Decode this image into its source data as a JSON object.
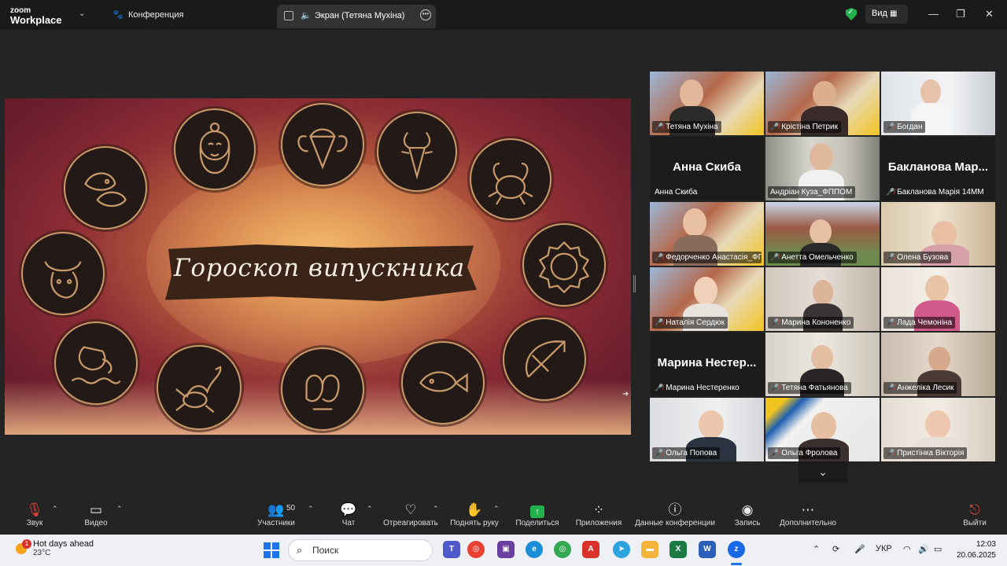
{
  "titlebar": {
    "logo_line1": "zoom",
    "logo_line2": "Workplace",
    "meeting_label": "Конференция",
    "share_tab_label": "Экран (Тетяна Мухіна)",
    "view_label": "Вид"
  },
  "slide": {
    "title": "Гороскоп випускника",
    "signs": [
      "virgo-sign-icon",
      "aries-sign-icon",
      "capricorn-sign-icon",
      "pisces-sign-icon",
      "cancer-sign-icon",
      "taurus-sign-icon",
      "leo-sign-icon",
      "aquarius-sign-icon",
      "scorpio-sign-icon",
      "gemini-sign-icon",
      "pisces-sign-icon",
      "sagittarius-sign-icon"
    ]
  },
  "gallery": {
    "tiles": [
      {
        "label": "Тетяна Мухіна",
        "muted": true
      },
      {
        "label": "Крістіна Петрик",
        "muted": true
      },
      {
        "label": "Богдан",
        "muted": true
      },
      {
        "label": "Анна Скиба",
        "big_name": "Анна Скиба",
        "muted": false
      },
      {
        "label": "Андріан Куза_ФППОМ",
        "muted": false,
        "active": true
      },
      {
        "label": "Бакланова Марія 14ММ",
        "big_name": "Бакланова Мар...",
        "muted": true
      },
      {
        "label": "Федорченко Анастасія_ФППОМ",
        "muted": true
      },
      {
        "label": "Анетта Омельченко",
        "muted": true
      },
      {
        "label": "Олена Бузова",
        "muted": true
      },
      {
        "label": "Наталія Сердюк",
        "muted": true
      },
      {
        "label": "Марина Кононенко",
        "muted": true
      },
      {
        "label": "Лада Чемоніна",
        "muted": true
      },
      {
        "label": "Марина Нестеренко",
        "big_name": "Марина Нестер...",
        "muted": true
      },
      {
        "label": "Тетяна Фатьянова",
        "muted": true
      },
      {
        "label": "Анжеліка Лесик",
        "muted": true
      },
      {
        "label": "Ольга Попова",
        "muted": true
      },
      {
        "label": "Ольга Фролова",
        "muted": true
      },
      {
        "label": "Пристінка Вікторія",
        "muted": true
      }
    ]
  },
  "toolbar": {
    "audio": "Звук",
    "video": "Видео",
    "participants": "Участники",
    "participants_count": "50",
    "chat": "Чат",
    "react": "Отреагировать",
    "raise_hand": "Поднять руку",
    "share": "Поделиться",
    "apps": "Приложения",
    "meeting_info": "Данные конференции",
    "record": "Запись",
    "more": "Дополнительно",
    "leave": "Выйти"
  },
  "taskbar": {
    "weather_title": "Hot days ahead",
    "weather_temp": "23°C",
    "weather_badge": "1",
    "search_placeholder": "Поиск",
    "language": "УКР",
    "time": "12:03",
    "date": "20.06.2025"
  },
  "colors": {
    "accent_green": "#23b14d",
    "active_speaker": "#2ecc71",
    "mute_red": "#e0453a"
  }
}
